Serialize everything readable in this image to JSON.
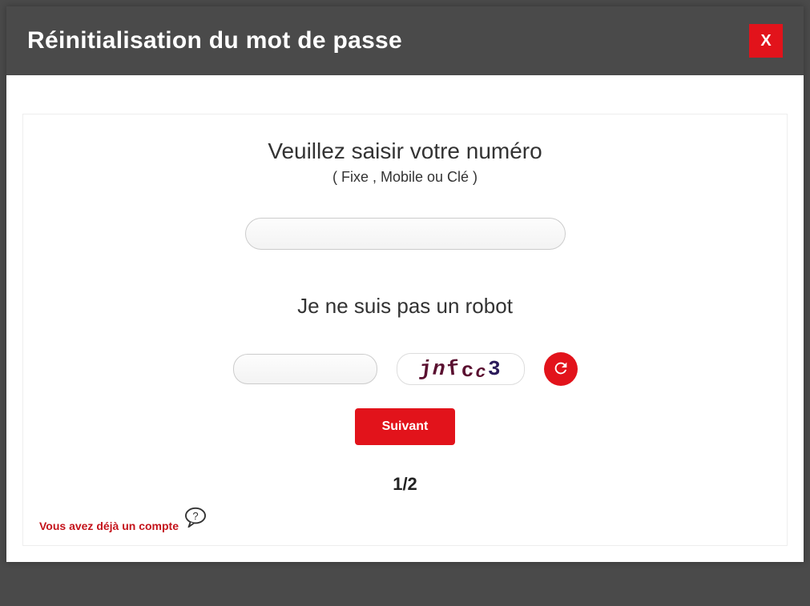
{
  "modal": {
    "title": "Réinitialisation du mot de passe",
    "close_label": "X"
  },
  "prompt": {
    "main": "Veuillez saisir votre numéro",
    "sub": "( Fixe , Mobile ou Clé )"
  },
  "number_input": {
    "value": "",
    "placeholder": ""
  },
  "captcha": {
    "label": "Je ne suis pas un robot",
    "input_value": "",
    "text": "jnfcc3"
  },
  "buttons": {
    "next": "Suivant"
  },
  "step": "1/2",
  "account_link": "Vous avez déjà un compte"
}
